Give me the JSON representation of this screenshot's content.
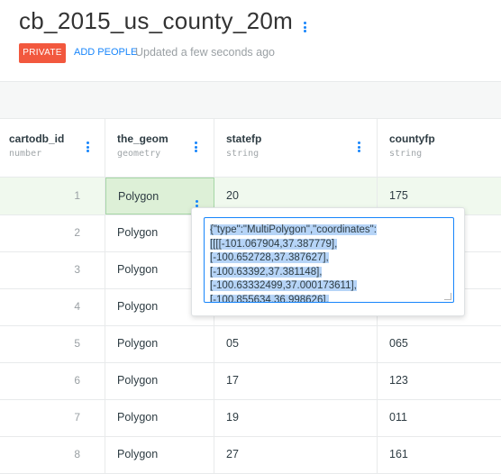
{
  "header": {
    "title": "cb_2015_us_county_20m",
    "badge": "PRIVATE",
    "add_people": "ADD PEOPLE",
    "updated": "Updated a few seconds ago"
  },
  "columns": [
    {
      "name": "cartodb_id",
      "type": "number"
    },
    {
      "name": "the_geom",
      "type": "geometry"
    },
    {
      "name": "statefp",
      "type": "string"
    },
    {
      "name": "countyfp",
      "type": "string"
    }
  ],
  "rows": [
    {
      "id": "1",
      "geom": "Polygon",
      "statefp": "20",
      "countyfp": "175"
    },
    {
      "id": "2",
      "geom": "Polygon",
      "statefp": "",
      "countyfp": ""
    },
    {
      "id": "3",
      "geom": "Polygon",
      "statefp": "",
      "countyfp": ""
    },
    {
      "id": "4",
      "geom": "Polygon",
      "statefp": "",
      "countyfp": ""
    },
    {
      "id": "5",
      "geom": "Polygon",
      "statefp": "05",
      "countyfp": "065"
    },
    {
      "id": "6",
      "geom": "Polygon",
      "statefp": "17",
      "countyfp": "123"
    },
    {
      "id": "7",
      "geom": "Polygon",
      "statefp": "19",
      "countyfp": "011"
    },
    {
      "id": "8",
      "geom": "Polygon",
      "statefp": "27",
      "countyfp": "161"
    }
  ],
  "editor": {
    "lines": [
      "{\"type\":\"MultiPolygon\",\"coordinates\":",
      "[[[[-101.067904,37.387779],",
      "[-100.652728,37.387627],",
      "[-100.63392,37.381148],",
      "[-100.63332499,37.000173611],",
      "[-100.855634,36.998626],"
    ]
  },
  "colors": {
    "accent": "#1785fb",
    "badge": "#f2583e",
    "selected_row": "#f0f9ee",
    "selection": "#b6d4f7"
  }
}
